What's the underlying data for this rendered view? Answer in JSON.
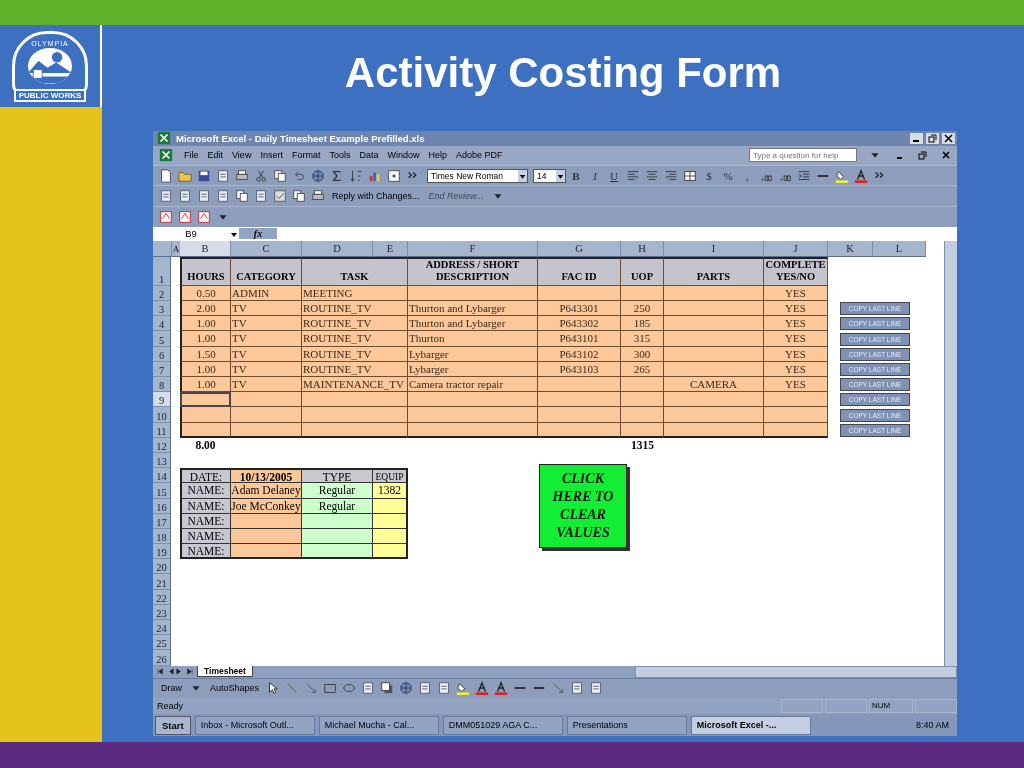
{
  "slide": {
    "title": "Activity Costing Form",
    "logo": {
      "arc_text": "OLYMPIA",
      "banner": "PUBLIC WORKS"
    }
  },
  "window": {
    "title": "Microsoft Excel - Daily Timesheet Example Prefilled.xls"
  },
  "menu": [
    "File",
    "Edit",
    "View",
    "Insert",
    "Format",
    "Tools",
    "Data",
    "Window",
    "Help",
    "Adobe PDF"
  ],
  "help_box": {
    "placeholder": "Type a question for help"
  },
  "formatting": {
    "font": "Times New Roman",
    "size": "14",
    "style_buttons": [
      "B",
      "I",
      "U"
    ],
    "number_buttons": [
      "$",
      "%",
      ","
    ]
  },
  "review_toolbar": [
    {
      "label": "Reply with Changes...",
      "disabled": false
    },
    {
      "label": "End Review...",
      "disabled": true
    }
  ],
  "formula_bar": {
    "name_box": "B9",
    "function_label": "fx"
  },
  "columns": [
    {
      "label": "A",
      "selected": false
    },
    {
      "label": "B",
      "selected": true
    },
    {
      "label": "C",
      "selected": false
    },
    {
      "label": "D",
      "selected": false
    },
    {
      "label": "E",
      "selected": false
    },
    {
      "label": "F",
      "selected": false
    },
    {
      "label": "G",
      "selected": false
    },
    {
      "label": "H",
      "selected": false
    },
    {
      "label": "I",
      "selected": false
    },
    {
      "label": "J",
      "selected": false
    },
    {
      "label": "K",
      "selected": false
    },
    {
      "label": "L",
      "selected": false
    }
  ],
  "row_numbers": [
    {
      "label": "1",
      "selected": false
    },
    {
      "label": "2",
      "selected": false
    },
    {
      "label": "3",
      "selected": false
    },
    {
      "label": "4",
      "selected": false
    },
    {
      "label": "5",
      "selected": false
    },
    {
      "label": "6",
      "selected": false
    },
    {
      "label": "7",
      "selected": false
    },
    {
      "label": "8",
      "selected": false
    },
    {
      "label": "9",
      "selected": true
    },
    {
      "label": "10",
      "selected": false
    },
    {
      "label": "11",
      "selected": false
    },
    {
      "label": "12",
      "selected": false
    },
    {
      "label": "13",
      "selected": false
    },
    {
      "label": "14",
      "selected": false
    },
    {
      "label": "15",
      "selected": false
    },
    {
      "label": "16",
      "selected": false
    },
    {
      "label": "17",
      "selected": false
    },
    {
      "label": "18",
      "selected": false
    },
    {
      "label": "19",
      "selected": false
    },
    {
      "label": "20",
      "selected": false
    },
    {
      "label": "21",
      "selected": false
    },
    {
      "label": "22",
      "selected": false
    },
    {
      "label": "23",
      "selected": false
    },
    {
      "label": "24",
      "selected": false
    },
    {
      "label": "25",
      "selected": false
    },
    {
      "label": "26",
      "selected": false
    }
  ],
  "timesheet": {
    "headers": [
      "HOURS",
      "CATEGORY",
      "TASK",
      "ADDRESS / SHORT DESCRIPTION",
      "FAC ID",
      "UOP",
      "PARTS",
      "COMPLETE YES/NO"
    ],
    "rows": [
      {
        "selected": false,
        "hours": "0.50",
        "category": "ADMIN",
        "task": "MEETING",
        "complete": "YES"
      },
      {
        "selected": false,
        "hours": "2.00",
        "category": "TV",
        "task": "ROUTINE_TV",
        "address": "Thurton and Lybarger",
        "fac_id": "P643301",
        "uop": "250",
        "complete": "YES"
      },
      {
        "selected": false,
        "hours": "1.00",
        "category": "TV",
        "task": "ROUTINE_TV",
        "address": "Thurton and Lybarger",
        "fac_id": "P643302",
        "uop": "185",
        "complete": "YES"
      },
      {
        "selected": false,
        "hours": "1.00",
        "category": "TV",
        "task": "ROUTINE_TV",
        "address": "Thurton",
        "fac_id": "P643101",
        "uop": "315",
        "complete": "YES"
      },
      {
        "selected": false,
        "hours": "1.50",
        "category": "TV",
        "task": "ROUTINE_TV",
        "address": "Lybarger",
        "fac_id": "P643102",
        "uop": "300",
        "complete": "YES"
      },
      {
        "selected": false,
        "hours": "1.00",
        "category": "TV",
        "task": "ROUTINE_TV",
        "address": "Lybarger",
        "fac_id": "P643103",
        "uop": "265",
        "complete": "YES"
      },
      {
        "selected": false,
        "hours": "1.00",
        "category": "TV",
        "task": "MAINTENANCE_TV",
        "address": "Camera tractor repair",
        "parts": "CAMERA",
        "complete": "YES"
      },
      {
        "selected": true
      },
      {
        "selected": false
      },
      {
        "selected": false
      }
    ],
    "totals": {
      "hours": "8.00",
      "uop": "1315"
    }
  },
  "copy_buttons": [
    "COPY LAST LINE",
    "COPY LAST LINE",
    "COPY LAST LINE",
    "COPY LAST LINE",
    "COPY LAST LINE",
    "COPY LAST LINE",
    "COPY LAST LINE",
    "COPY LAST LINE",
    "COPY LAST LINE"
  ],
  "crew": {
    "date_label": "DATE:",
    "date": "10/13/2005",
    "type_header": "TYPE",
    "equip_header": "EQUIP",
    "rows": [
      {
        "label": "NAME:",
        "name": "Adam Delaney",
        "type": "Regular",
        "equip": "1382"
      },
      {
        "label": "NAME:",
        "name": "Joe McConkey",
        "type": "Regular"
      },
      {
        "label": "NAME:"
      },
      {
        "label": "NAME:"
      },
      {
        "label": "NAME:"
      }
    ]
  },
  "clear_button": "CLICK HERE TO CLEAR VALUES",
  "sheet_tabs": [
    {
      "label": "Timesheet",
      "selected": true
    }
  ],
  "drawing_toolbar": {
    "draw": "Draw",
    "autoshapes": "AutoShapes"
  },
  "status_bar": {
    "text": "Ready",
    "indicator": "NUM"
  },
  "taskbar": {
    "start": "Start",
    "items": [
      {
        "label": "Inbox - Microsoft Outl...",
        "selected": false
      },
      {
        "label": "Michael Mucha - Cal...",
        "selected": false
      },
      {
        "label": "DMM051029 AGA C...",
        "selected": false
      },
      {
        "label": "Presentations",
        "selected": false
      },
      {
        "label": "Microsoft Excel -...",
        "selected": true
      }
    ],
    "clock": "8:40 AM"
  }
}
